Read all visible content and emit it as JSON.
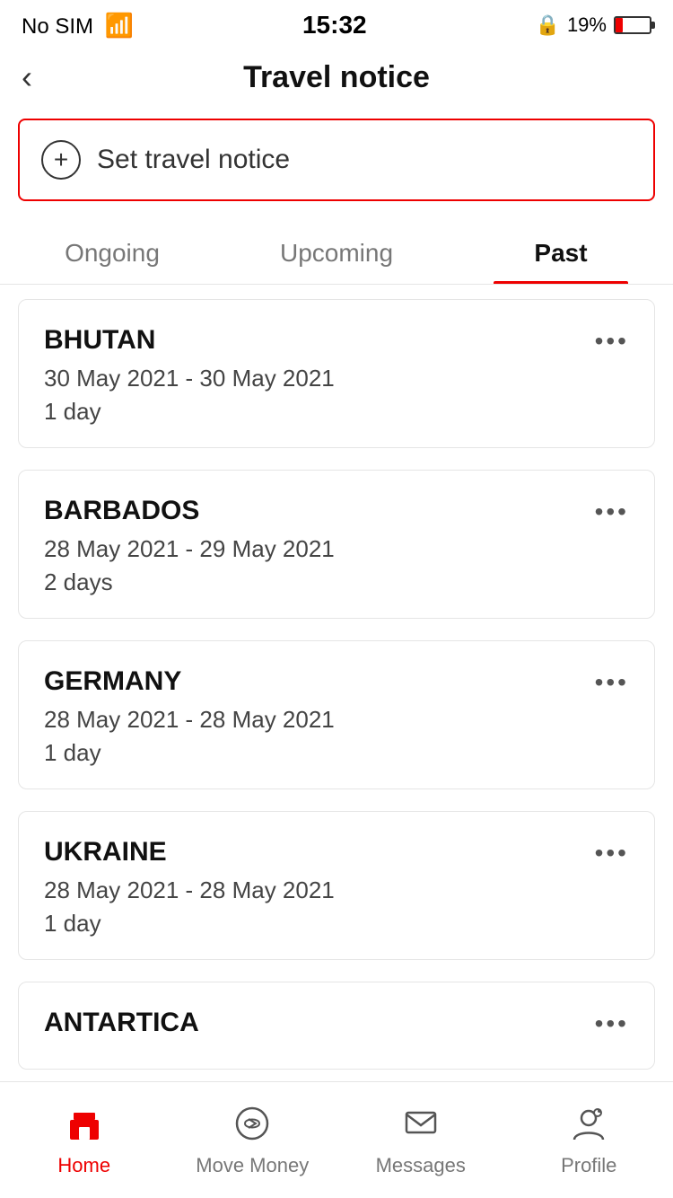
{
  "statusBar": {
    "carrier": "No SIM",
    "time": "15:32",
    "battery": "19%"
  },
  "header": {
    "title": "Travel notice",
    "backLabel": "<"
  },
  "setNoticeButton": {
    "label": "Set travel notice"
  },
  "tabs": [
    {
      "id": "ongoing",
      "label": "Ongoing",
      "active": false
    },
    {
      "id": "upcoming",
      "label": "Upcoming",
      "active": false
    },
    {
      "id": "past",
      "label": "Past",
      "active": true
    }
  ],
  "travelCards": [
    {
      "country": "BHUTAN",
      "dates": "30 May 2021 - 30 May 2021",
      "duration": "1 day"
    },
    {
      "country": "BARBADOS",
      "dates": "28 May 2021 - 29 May 2021",
      "duration": "2 days"
    },
    {
      "country": "GERMANY",
      "dates": "28 May 2021 - 28 May 2021",
      "duration": "1 day"
    },
    {
      "country": "UKRAINE",
      "dates": "28 May 2021 - 28 May 2021",
      "duration": "1 day"
    },
    {
      "country": "ANTARTICA",
      "dates": "",
      "duration": ""
    }
  ],
  "bottomNav": {
    "items": [
      {
        "id": "home",
        "label": "Home",
        "active": true
      },
      {
        "id": "move-money",
        "label": "Move Money",
        "active": false
      },
      {
        "id": "messages",
        "label": "Messages",
        "active": false
      },
      {
        "id": "profile",
        "label": "Profile",
        "active": false
      }
    ]
  }
}
